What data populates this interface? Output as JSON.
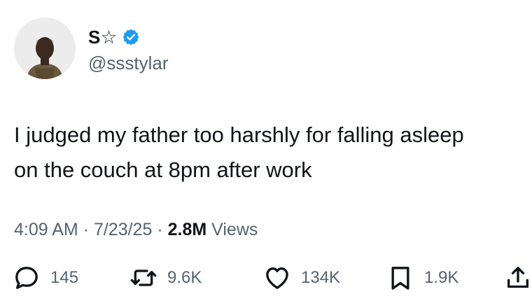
{
  "author": {
    "display_name": "S☆",
    "handle": "@ssstylar",
    "verified": true,
    "verified_color": "#1d9bf0"
  },
  "tweet": {
    "text_line1": "I judged my father too harshly for falling asleep",
    "text_line2": "on the couch at 8pm after work"
  },
  "meta": {
    "time": "4:09 AM",
    "sep1": " · ",
    "date": "7/23/25",
    "sep2": " · ",
    "views_count": "2.8M",
    "views_label": " Views"
  },
  "actions": {
    "reply": {
      "icon": "reply-icon",
      "count": "145"
    },
    "retweet": {
      "icon": "retweet-icon",
      "count": "9.6K"
    },
    "like": {
      "icon": "heart-icon",
      "count": "134K"
    },
    "bookmark": {
      "icon": "bookmark-icon",
      "count": "1.9K"
    },
    "share": {
      "icon": "share-icon"
    }
  },
  "colors": {
    "text": "#0f1419",
    "secondary": "#536471",
    "background": "#ffffff"
  }
}
